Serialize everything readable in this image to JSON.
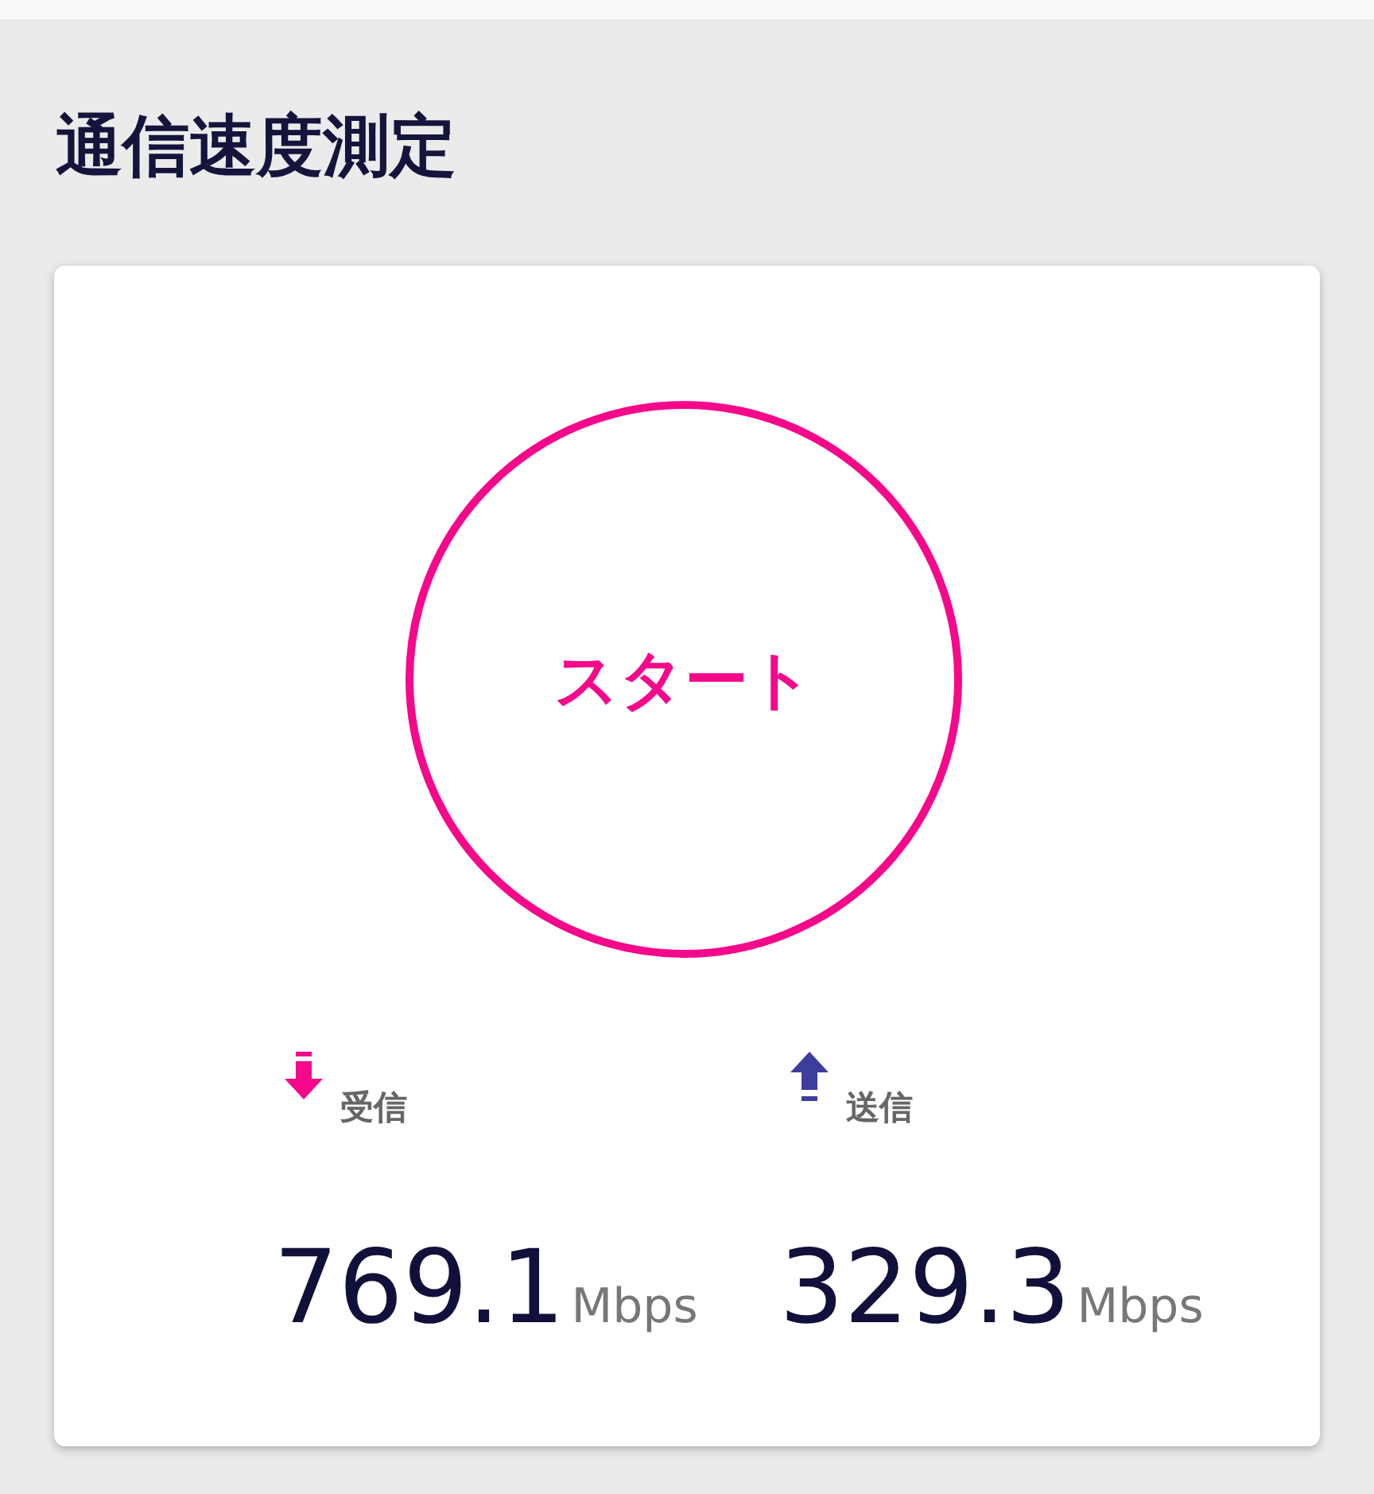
{
  "title": "通信速度測定",
  "start_button": {
    "label": "スタート"
  },
  "results": [
    {
      "kind": "download",
      "label": "受信",
      "value": "769.1",
      "unit": "Mbps"
    },
    {
      "kind": "upload",
      "label": "送信",
      "value": "329.3",
      "unit": "Mbps"
    }
  ]
}
